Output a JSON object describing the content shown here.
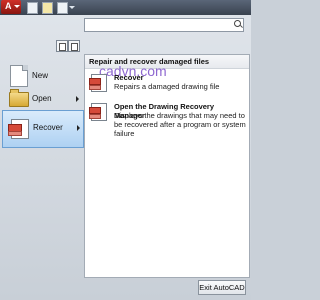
{
  "app": {
    "logo_letter": "A"
  },
  "search": {
    "placeholder": ""
  },
  "nav": [
    {
      "label": "New",
      "has_submenu": false,
      "active": false
    },
    {
      "label": "Open",
      "has_submenu": true,
      "active": false
    },
    {
      "label": "Recover",
      "has_submenu": true,
      "active": true
    }
  ],
  "content": {
    "header": "Repair and recover damaged files",
    "watermark": "cadvn.com",
    "items": [
      {
        "title": "Recover",
        "description": "Repairs a damaged drawing file"
      },
      {
        "title": "Open the Drawing Recovery Manager",
        "description": "Displays the drawings that may need to be recovered after a program or system failure"
      }
    ]
  },
  "footer": {
    "exit_label": "Exit AutoCAD"
  },
  "colors": {
    "accent": "#aed1f2",
    "logo": "#c02820"
  }
}
